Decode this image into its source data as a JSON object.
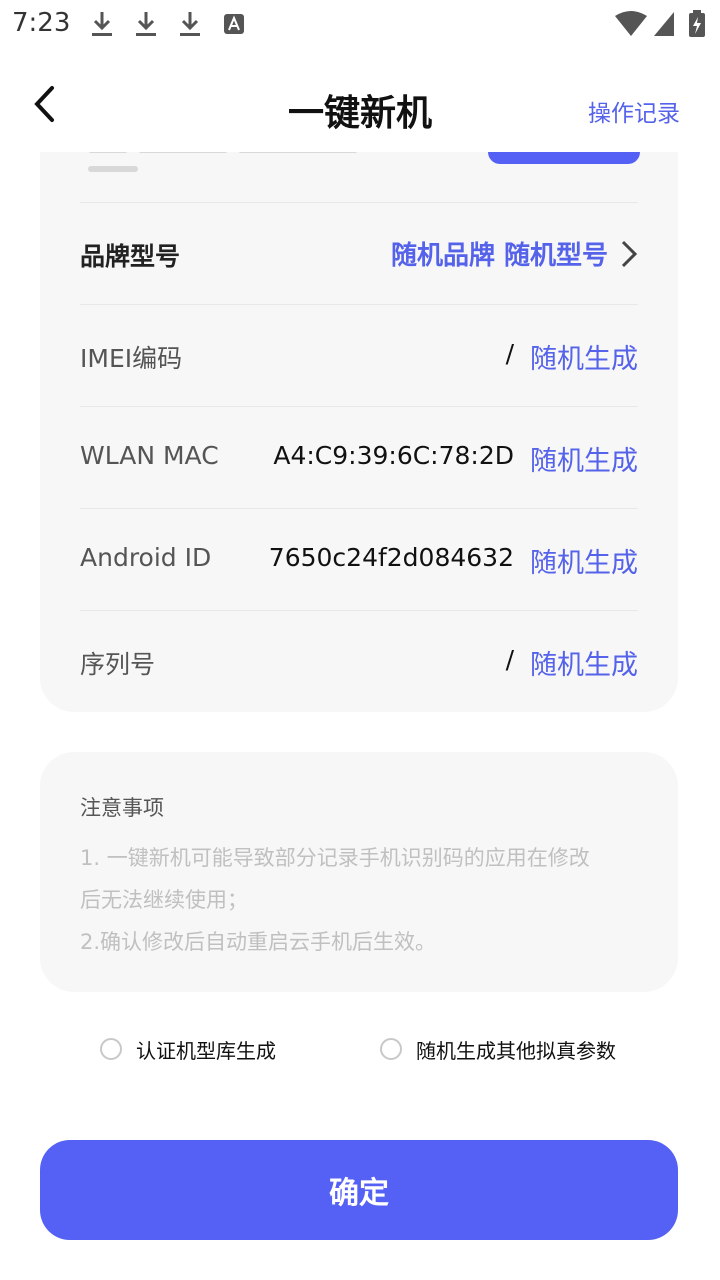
{
  "status_bar": {
    "time": "7:23",
    "left_icons": [
      "download-icon",
      "download-icon",
      "download-icon",
      "text-a-icon"
    ],
    "right_icons": [
      "wifi-icon",
      "signal-icon",
      "battery-charging-icon"
    ]
  },
  "header": {
    "title": "一键新机",
    "right_link": "操作记录",
    "back_icon": "chevron-left-icon"
  },
  "device_card": {
    "rows": [
      {
        "label": "品牌型号",
        "value": "随机品牌 随机型号",
        "action": ""
      },
      {
        "label": "IMEI编码",
        "value": "/",
        "action": "随机生成"
      },
      {
        "label": "WLAN MAC",
        "value": "A4:C9:39:6C:78:2D",
        "action": "随机生成"
      },
      {
        "label": "Android ID",
        "value": "7650c24f2d084632",
        "action": "随机生成"
      },
      {
        "label": "序列号",
        "value": "/",
        "action": "随机生成"
      }
    ]
  },
  "notice": {
    "title": "注意事项",
    "lines": [
      "1. 一键新机可能导致部分记录手机识别码的应用在修改",
      "后无法继续使用；",
      "2.确认修改后自动重启云手机后生效。"
    ]
  },
  "options": [
    {
      "label": "认证机型库生成",
      "checked": false
    },
    {
      "label": "随机生成其他拟真参数",
      "checked": false
    }
  ],
  "confirm": {
    "label": "确定"
  },
  "colors": {
    "accent": "#5561f4",
    "link": "#5562ea",
    "card_bg": "#f7f7f7"
  }
}
